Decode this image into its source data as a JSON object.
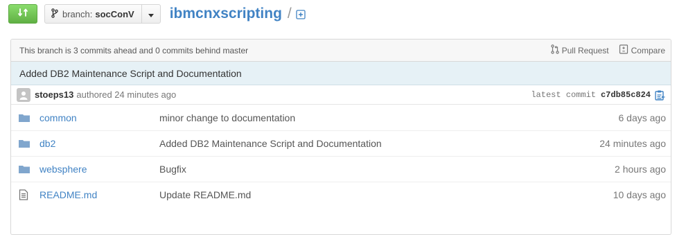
{
  "header": {
    "compare_icon": "compare-arrows-icon",
    "branch_icon": "git-branch-icon",
    "branch_label": "branch:",
    "branch_name": "socConV",
    "caret_icon": "caret-down-icon",
    "repo_name": "ibmcnxscripting",
    "crumb_separator": "/",
    "new_file_icon": "plus-file-icon"
  },
  "tease": {
    "text": "This branch is 3 commits ahead and 0 commits behind master",
    "pull_request_label": "Pull Request",
    "compare_label": "Compare"
  },
  "commit": {
    "title": "Added DB2 Maintenance Script and Documentation",
    "author": "stoeps13",
    "authored": "authored 24 minutes ago",
    "latest_label": "latest commit",
    "sha": "c7db85c824",
    "copy_icon": "clipboard-icon"
  },
  "files": [
    {
      "type": "directory",
      "icon": "folder-icon",
      "name": "common",
      "message": "minor change to documentation",
      "age": "6 days ago"
    },
    {
      "type": "directory",
      "icon": "folder-icon",
      "name": "db2",
      "message": "Added DB2 Maintenance Script and Documentation",
      "age": "24 minutes ago"
    },
    {
      "type": "directory",
      "icon": "folder-icon",
      "name": "websphere",
      "message": "Bugfix",
      "age": "2 hours ago"
    },
    {
      "type": "file",
      "icon": "file-text-icon",
      "name": "README.md",
      "message": "Update README.md",
      "age": "10 days ago"
    }
  ],
  "colors": {
    "accent_green": "#60b044",
    "link_blue": "#4183c4",
    "commit_bar": "#e6f1f6"
  }
}
